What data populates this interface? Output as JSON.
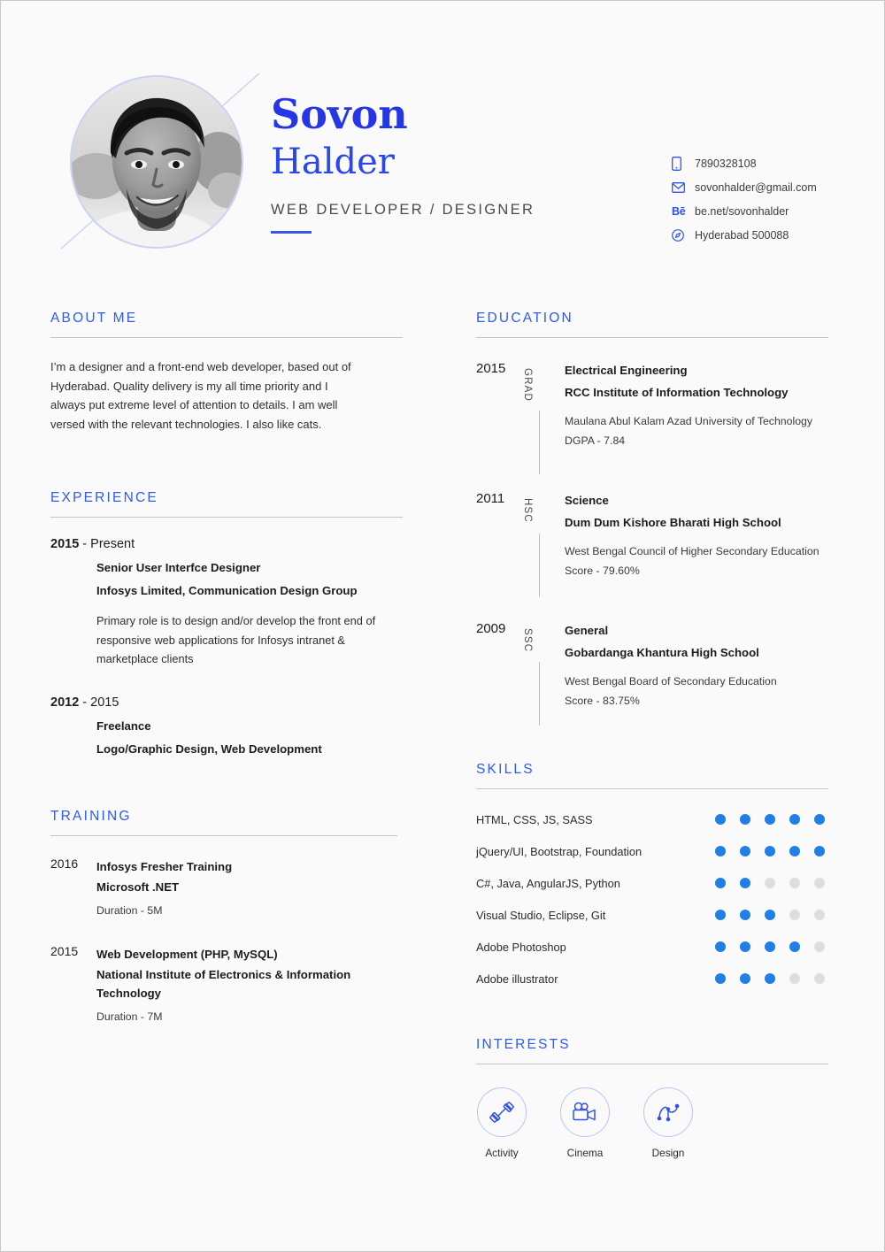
{
  "theme": {
    "accent_blue": "#2f5bef",
    "name_blue": "#2436e6",
    "dot_on": "#1f7fe6",
    "dot_off": "#dddddd",
    "page_bg": "#fafafa"
  },
  "header": {
    "first_name": "Sovon",
    "last_name": "Halder",
    "job_title": "WEB DEVELOPER / DESIGNER",
    "photo_alt": "portrait-photo"
  },
  "contact": [
    {
      "icon": "phone-icon",
      "text": "7890328108"
    },
    {
      "icon": "email-icon",
      "text": "sovonhalder@gmail.com"
    },
    {
      "icon": "behance-icon",
      "text": "be.net/sovonhalder",
      "glyph": "Bē"
    },
    {
      "icon": "location-icon",
      "text": "Hyderabad 500088"
    }
  ],
  "about": {
    "title": "ABOUT ME",
    "text": "I’m a designer and a front-end web developer, based out of Hyderabad. Quality delivery is my all time priority and I always put extreme level of attention to details. I am well versed with the relevant technologies. I also like cats."
  },
  "experience": {
    "title": "EXPERIENCE",
    "items": [
      {
        "date_bold": "2015",
        "date_rest": " - Present",
        "role": "Senior User Interfce Designer",
        "company": "Infosys Limited, Communication Design Group",
        "description": "Primary role is to design and/or develop the front end of responsive web applications for Infosys intranet & marketplace clients"
      },
      {
        "date_bold": "2012",
        "date_rest": " - 2015",
        "role": "Freelance",
        "company": "Logo/Graphic Design, Web Development",
        "description": ""
      }
    ]
  },
  "training": {
    "title": "TRAINING",
    "items": [
      {
        "year": "2016",
        "name": "Infosys Fresher Training",
        "org": "Microsoft .NET",
        "duration": "Duration - 5M"
      },
      {
        "year": "2015",
        "name": "Web Development (PHP, MySQL)",
        "org": "National Institute of Electronics & Information Technology",
        "duration": "Duration - 7M"
      }
    ]
  },
  "education": {
    "title": "EDUCATION",
    "items": [
      {
        "year": "2015",
        "tag": "GRAD",
        "major": "Electrical Engineering",
        "school": "RCC Institute of Information  Technology",
        "board": "Maulana Abul Kalam Azad University of Technology",
        "score": "DGPA - 7.84"
      },
      {
        "year": "2011",
        "tag": "HSC",
        "major": "Science",
        "school": "Dum Dum Kishore Bharati High School",
        "board": "West Bengal Council of Higher Secondary Education",
        "score": "Score - 79.60%"
      },
      {
        "year": "2009",
        "tag": "SSC",
        "major": "General",
        "school": "Gobardanga Khantura High School",
        "board": "West Bengal Board of Secondary Education",
        "score": "Score - 83.75%"
      }
    ]
  },
  "skills": {
    "title": "SKILLS",
    "max_rating": 5,
    "items": [
      {
        "name": "HTML, CSS, JS, SASS",
        "rating": 5
      },
      {
        "name": "jQuery/UI, Bootstrap, Foundation",
        "rating": 5
      },
      {
        "name": "C#, Java, AngularJS, Python",
        "rating": 2
      },
      {
        "name": "Visual Studio, Eclipse, Git",
        "rating": 3
      },
      {
        "name": "Adobe Photoshop",
        "rating": 4
      },
      {
        "name": "Adobe illustrator",
        "rating": 3
      }
    ]
  },
  "interests": {
    "title": "INTERESTS",
    "items": [
      {
        "label": "Activity",
        "icon": "dumbbell-icon"
      },
      {
        "label": "Cinema",
        "icon": "movie-camera-icon"
      },
      {
        "label": "Design",
        "icon": "bezier-pen-icon"
      }
    ]
  }
}
